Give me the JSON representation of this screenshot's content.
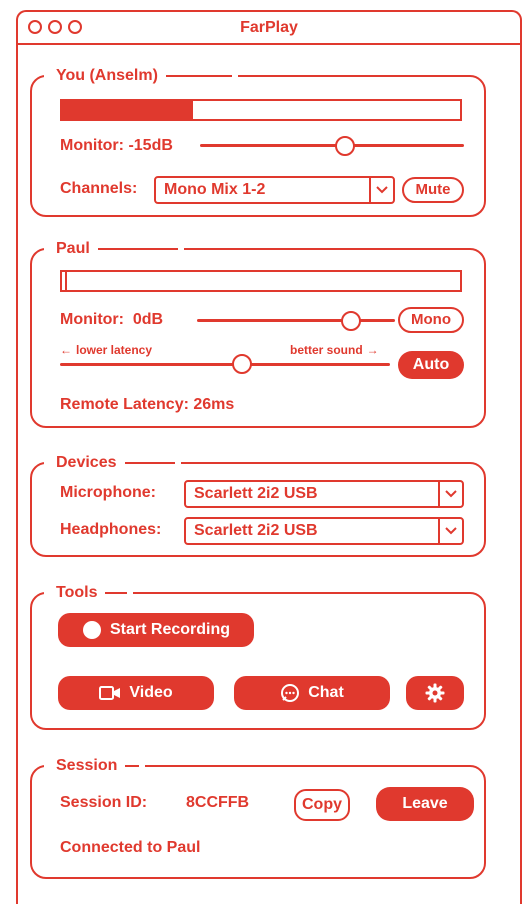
{
  "window": {
    "title": "FarPlay"
  },
  "you": {
    "legend": "You (Anselm)",
    "meter_level": 0.33,
    "monitor_label": "Monitor:",
    "monitor_value": "-15dB",
    "monitor_slider": 0.55,
    "channels_label": "Channels:",
    "channels_value": "Mono Mix 1-2",
    "mute_label": "Mute"
  },
  "paul": {
    "legend": "Paul",
    "meter_level": 0.0,
    "monitor_label": "Monitor:",
    "monitor_value": "0dB",
    "monitor_slider": 0.78,
    "mono_label": "Mono",
    "lower_latency_label": "lower latency",
    "better_sound_label": "better sound",
    "latency_slider": 0.55,
    "auto_label": "Auto",
    "remote_latency_label": "Remote Latency:",
    "remote_latency_value": "26ms"
  },
  "devices": {
    "legend": "Devices",
    "microphone_label": "Microphone:",
    "microphone_value": "Scarlett 2i2 USB",
    "headphones_label": "Headphones:",
    "headphones_value": "Scarlett 2i2 USB"
  },
  "tools": {
    "legend": "Tools",
    "record_label": "Start Recording",
    "video_label": "Video",
    "chat_label": "Chat",
    "icons": {
      "record": "record-dot-icon",
      "video": "video-camera-icon",
      "chat": "chat-bubble-icon",
      "settings": "gear-icon"
    }
  },
  "session": {
    "legend": "Session",
    "id_label": "Session ID:",
    "id_value": "8CCFFB",
    "copy_label": "Copy",
    "leave_label": "Leave",
    "status": "Connected to Paul"
  },
  "colors": {
    "accent": "#e0392e",
    "background": "#ffffff"
  }
}
